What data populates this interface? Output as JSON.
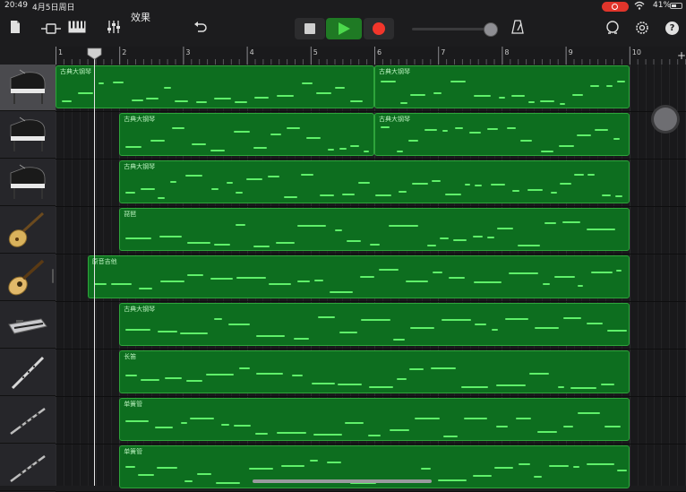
{
  "status_bar": {
    "time": "20:49",
    "date": "4月5日周日",
    "battery": "41%"
  },
  "toolbar": {
    "fx_label": "效果",
    "icons": [
      "document-icon",
      "track-view-icon",
      "keyboard-icon",
      "mixer-icon",
      "undo-icon",
      "metronome-icon",
      "loop-icon",
      "settings-icon",
      "help-icon"
    ],
    "help_glyph": "?"
  },
  "ruler": {
    "bars": [
      "1",
      "2",
      "3",
      "4",
      "5",
      "6",
      "7",
      "8",
      "9",
      "10"
    ],
    "add_glyph": "+"
  },
  "colors": {
    "region_fill": "#0d6e1f",
    "region_border": "#2ea43b",
    "note": "#5ff06a",
    "play": "#4cd94c",
    "record": "#f2362b"
  },
  "tracks": [
    {
      "instrument": "grand-piano-icon",
      "selected": true,
      "regions": [
        {
          "label": "古典大钢琴",
          "start": 1.0,
          "end": 6.0
        },
        {
          "label": "古典大钢琴",
          "start": 6.0,
          "end": 10.0
        }
      ]
    },
    {
      "instrument": "grand-piano-icon",
      "selected": false,
      "regions": [
        {
          "label": "古典大钢琴",
          "start": 2.0,
          "end": 6.0
        },
        {
          "label": "古典大钢琴",
          "start": 6.0,
          "end": 10.0
        }
      ]
    },
    {
      "instrument": "grand-piano-icon",
      "selected": false,
      "regions": [
        {
          "label": "古典大钢琴",
          "start": 2.0,
          "end": 10.0
        }
      ]
    },
    {
      "instrument": "pipa-icon",
      "selected": false,
      "regions": [
        {
          "label": "琵琶",
          "start": 2.0,
          "end": 10.0
        }
      ]
    },
    {
      "instrument": "acoustic-guitar-icon",
      "selected": false,
      "regions": [
        {
          "label": "原音吉他",
          "start": 1.5,
          "end": 10.0
        }
      ]
    },
    {
      "instrument": "keyboard-synth-icon",
      "selected": false,
      "regions": [
        {
          "label": "古典大钢琴",
          "start": 2.0,
          "end": 10.0
        }
      ]
    },
    {
      "instrument": "flute-icon",
      "selected": false,
      "regions": [
        {
          "label": "长笛",
          "start": 2.0,
          "end": 10.0
        }
      ]
    },
    {
      "instrument": "bamboo-flute-icon",
      "selected": false,
      "regions": [
        {
          "label": "单簧管",
          "start": 2.0,
          "end": 10.0
        }
      ]
    },
    {
      "instrument": "bamboo-flute-icon",
      "selected": false,
      "regions": [
        {
          "label": "单簧管",
          "start": 2.0,
          "end": 10.0
        }
      ]
    }
  ],
  "playhead_bar": 1.6
}
